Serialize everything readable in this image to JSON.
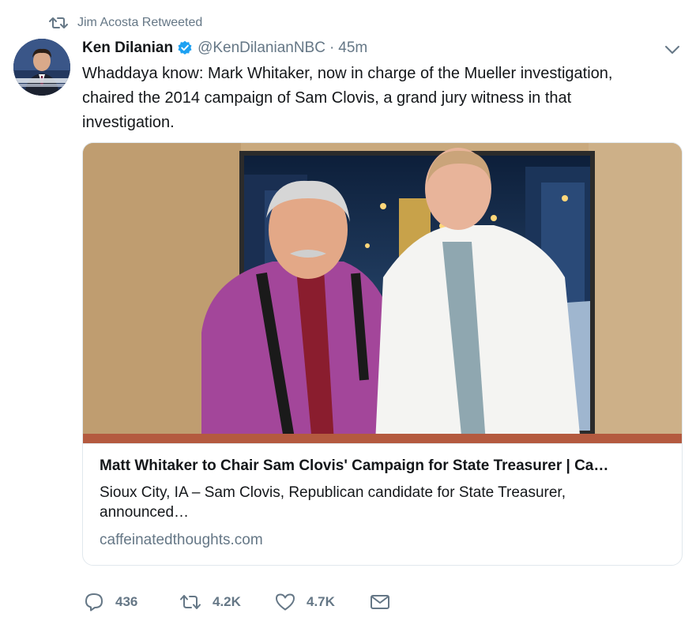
{
  "retweet_context": {
    "label": "Jim Acosta Retweeted",
    "icon": "retweet-icon"
  },
  "author": {
    "display_name": "Ken Dilanian",
    "handle": "@KenDilanianNBC",
    "separator": "·",
    "time": "45m",
    "verified_icon": "verified-badge-icon",
    "avatar_icon": "avatar"
  },
  "tweet": {
    "text": "Whaddaya know: Mark Whitaker, now in charge of the Mueller investigation, chaired the 2014 campaign of Sam Clovis, a grand jury witness in that investigation."
  },
  "card": {
    "title": "Matt Whitaker to Chair Sam Clovis' Campaign for State Treasurer | Ca…",
    "description": "Sioux City, IA – Sam Clovis, Republican candidate for State Treasurer, announced…",
    "domain": "caffeinatedthoughts.com"
  },
  "actions": {
    "reply": {
      "icon": "reply-icon",
      "count": "436"
    },
    "retweet": {
      "icon": "retweet-icon",
      "count": "4.2K"
    },
    "like": {
      "icon": "heart-icon",
      "count": "4.7K"
    },
    "message": {
      "icon": "envelope-icon"
    }
  },
  "colors": {
    "text_primary": "#14171a",
    "text_secondary": "#657786",
    "verified_blue": "#1da1f2",
    "border": "#e1e8ed"
  }
}
